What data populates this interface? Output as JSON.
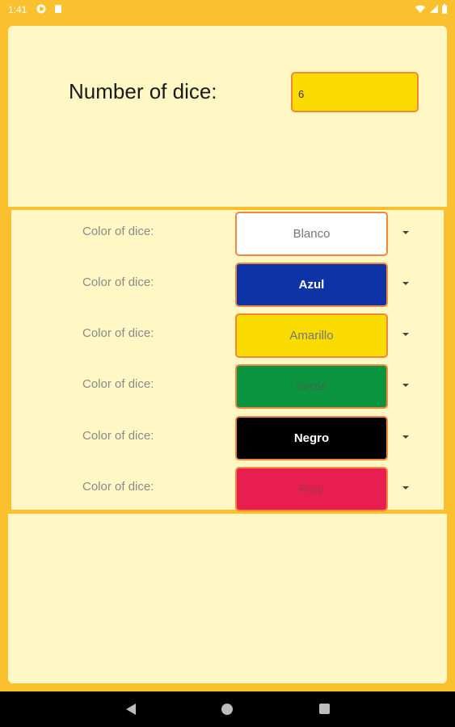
{
  "status_bar": {
    "time": "1:41",
    "icons": [
      "notification-app-icon",
      "sd-card-icon",
      "wifi-icon",
      "signal-icon",
      "battery-icon"
    ]
  },
  "number_of_dice": {
    "label": "Number of dice:",
    "value": "6"
  },
  "dice_rows": [
    {
      "label": "Color of dice:",
      "value": "Blanco",
      "bg": "#FFFFFF",
      "fg": "#777777"
    },
    {
      "label": "Color of dice:",
      "value": "Azul",
      "bg": "#0D33A6",
      "fg": "#FFFFFF"
    },
    {
      "label": "Color of dice:",
      "value": "Amarillo",
      "bg": "#FADC00",
      "fg": "#777777"
    },
    {
      "label": "Color of dice:",
      "value": "Verde",
      "bg": "#0A9440",
      "fg": "#3E6B4A"
    },
    {
      "label": "Color of dice:",
      "value": "Negro",
      "bg": "#000000",
      "fg": "#FFFFFF"
    },
    {
      "label": "Color of dice:",
      "value": "Rojo",
      "bg": "#E91E50",
      "fg": "#A8324E"
    }
  ],
  "colors": {
    "background": "#FBC02D",
    "panel": "#FFF8C5",
    "accent_border": "#F2863A"
  },
  "nav_bar": {
    "icons": [
      "back-icon",
      "home-icon",
      "recents-icon"
    ]
  }
}
